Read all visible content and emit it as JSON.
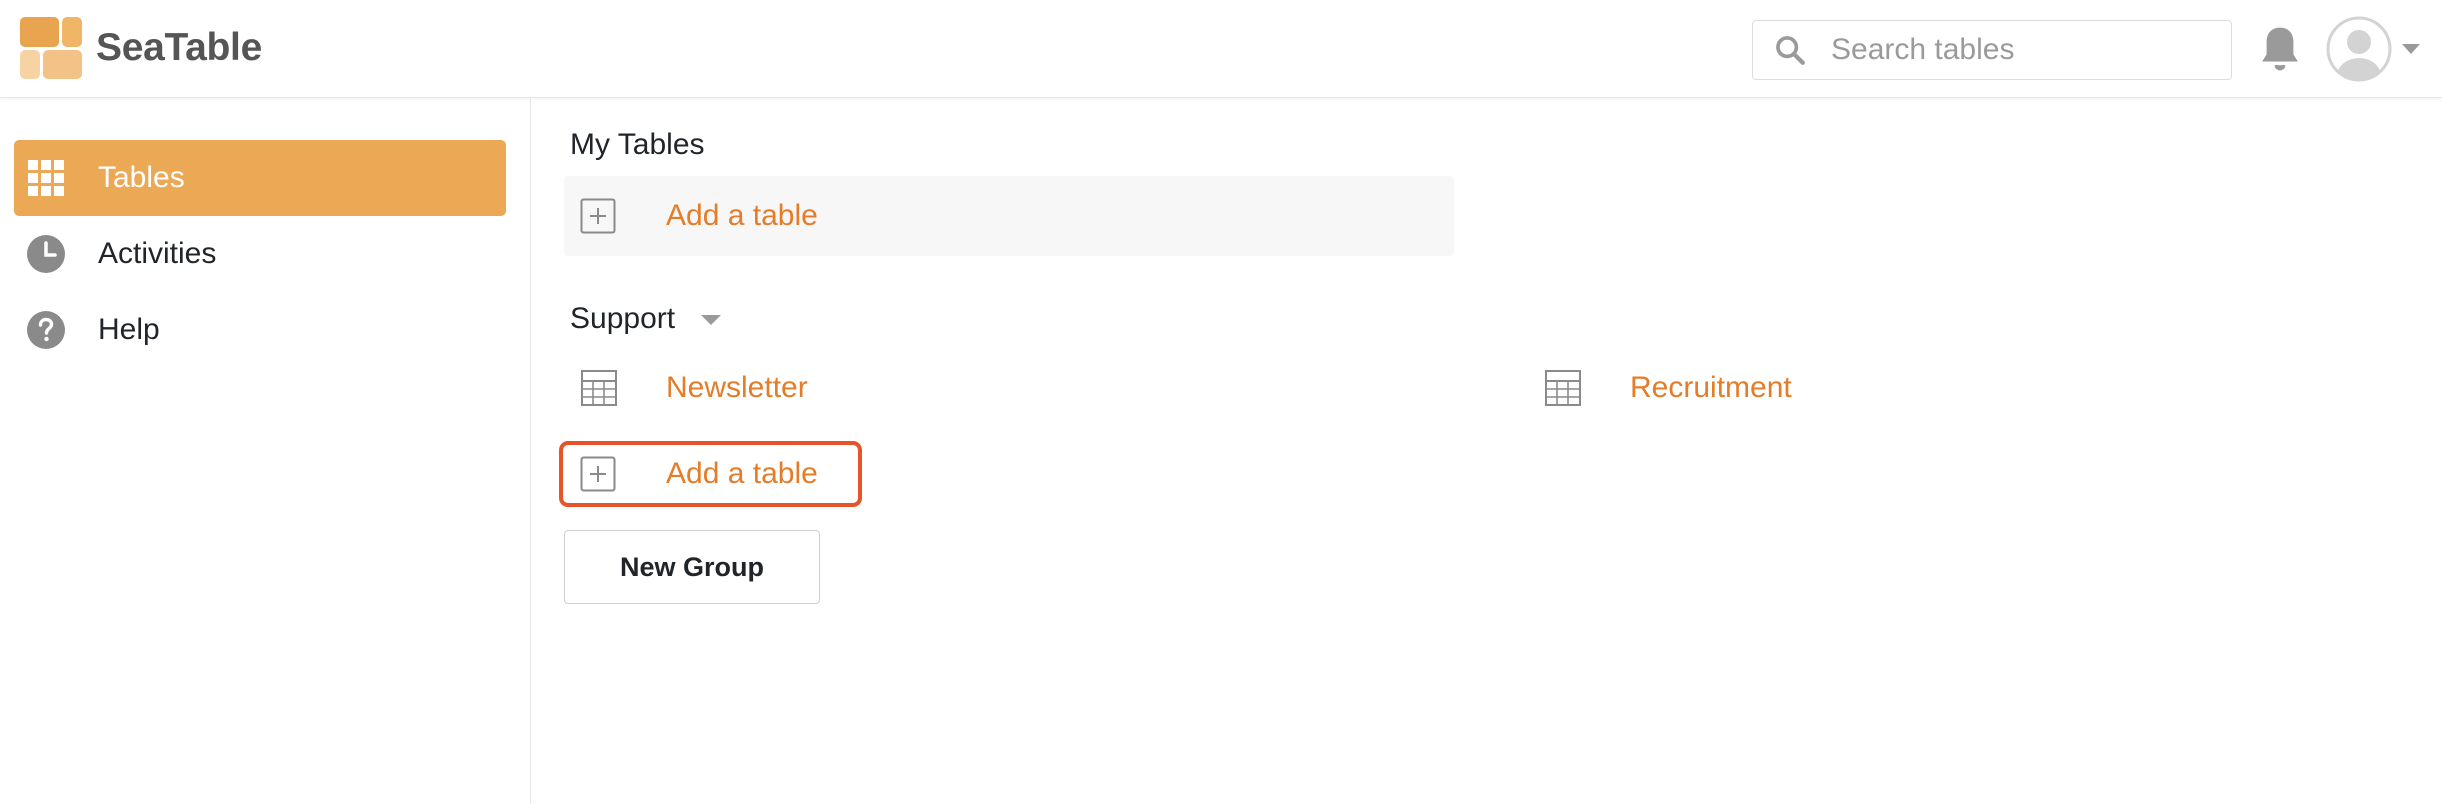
{
  "app": {
    "brand": "SeaTable",
    "colors": {
      "accent": "#eba955",
      "link": "#e57c28",
      "highlight_border": "#e8542a"
    }
  },
  "header": {
    "search": {
      "placeholder": "Search tables",
      "value": ""
    },
    "icons": [
      "search-icon",
      "bell-icon",
      "user-avatar-icon",
      "chevron-down-icon"
    ]
  },
  "sidebar": {
    "items": [
      {
        "label": "Tables",
        "icon": "grid-icon",
        "active": true
      },
      {
        "label": "Activities",
        "icon": "clock-icon",
        "active": false
      },
      {
        "label": "Help",
        "icon": "question-icon",
        "active": false
      }
    ]
  },
  "main": {
    "my_tables": {
      "title": "My Tables",
      "add_label": "Add a table"
    },
    "support": {
      "title": "Support",
      "tables": [
        {
          "name": "Newsletter",
          "icon": "table-icon"
        },
        {
          "name": "Recruitment",
          "icon": "table-icon"
        }
      ],
      "add_label": "Add a table"
    },
    "new_group_label": "New Group"
  }
}
